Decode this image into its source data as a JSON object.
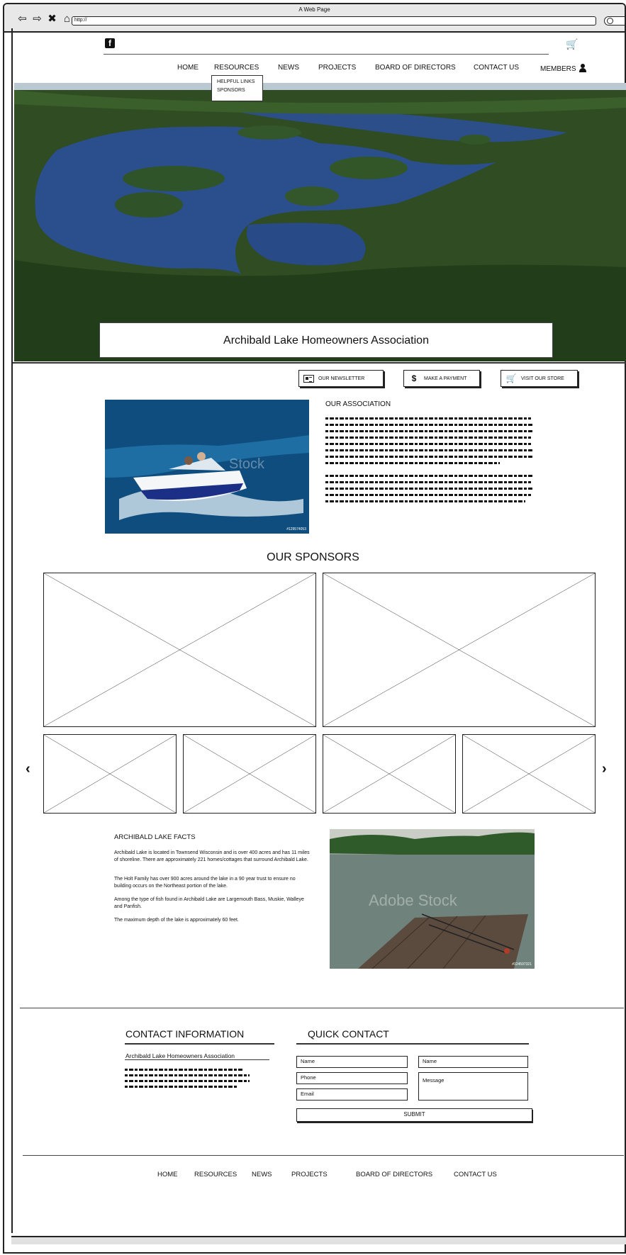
{
  "window": {
    "title": "A Web Page",
    "url": "http://"
  },
  "nav": {
    "items": [
      "HOME",
      "RESOURCES",
      "NEWS",
      "PROJECTS",
      "BOARD OF DIRECTORS",
      "CONTACT US",
      "MEMBERS"
    ],
    "dropdown": [
      "HELPFUL LINKS",
      "SPONSORS"
    ]
  },
  "hero": {
    "caption": "Archibald Lake Homeowners Association"
  },
  "actions": {
    "newsletter": "OUR NEWSLETTER",
    "payment": "MAKE A PAYMENT",
    "payment_icon": "$",
    "store": "VISIT OUR STORE"
  },
  "about": {
    "heading": "OUR ASSOCIATION",
    "watermark": "Stock",
    "image_id": "#129574053"
  },
  "sponsors": {
    "heading": "OUR SPONSORS"
  },
  "facts": {
    "heading": "ARCHIBALD LAKE FACTS",
    "paragraphs": [
      "Archibald Lake is located in Townsend Wisconsin and is over 400 acres and has 11 miles of shoreline. There are approximately 221 homes/cottages that surround Archibald Lake.",
      "The Holt Family has over 900 acres around the lake in a 90 year trust to ensure no building occurs on the Northeast portion of the lake.",
      "Among the type of fish found in Archibald Lake are Largemouth Bass, Muskie, Walleye and Panfish.",
      "The maximum depth of the lake is approximately 60 feet."
    ],
    "watermark": "Adobe Stock",
    "image_id": "#124597321"
  },
  "contact": {
    "heading": "CONTACT INFORMATION",
    "org": "Archibald Lake Homeowners Association"
  },
  "quick_contact": {
    "heading": "QUICK CONTACT",
    "fields": {
      "name1": "Name",
      "name2": "Name",
      "phone": "Phone",
      "message": "Message",
      "email": "Email"
    },
    "submit": "SUBMIT"
  },
  "footer": {
    "items": [
      "HOME",
      "RESOURCES",
      "NEWS",
      "PROJECTS",
      "BOARD OF DIRECTORS",
      "CONTACT US"
    ]
  },
  "icons": [
    "back-icon",
    "forward-icon",
    "stop-icon",
    "home-icon",
    "facebook-icon",
    "cart-icon",
    "user-icon",
    "newsletter-icon",
    "dollar-icon",
    "search-icon"
  ],
  "colors": {
    "lake_blue": "#2a4f8c",
    "forest_green": "#2f4f1f",
    "frame": "#222222"
  }
}
